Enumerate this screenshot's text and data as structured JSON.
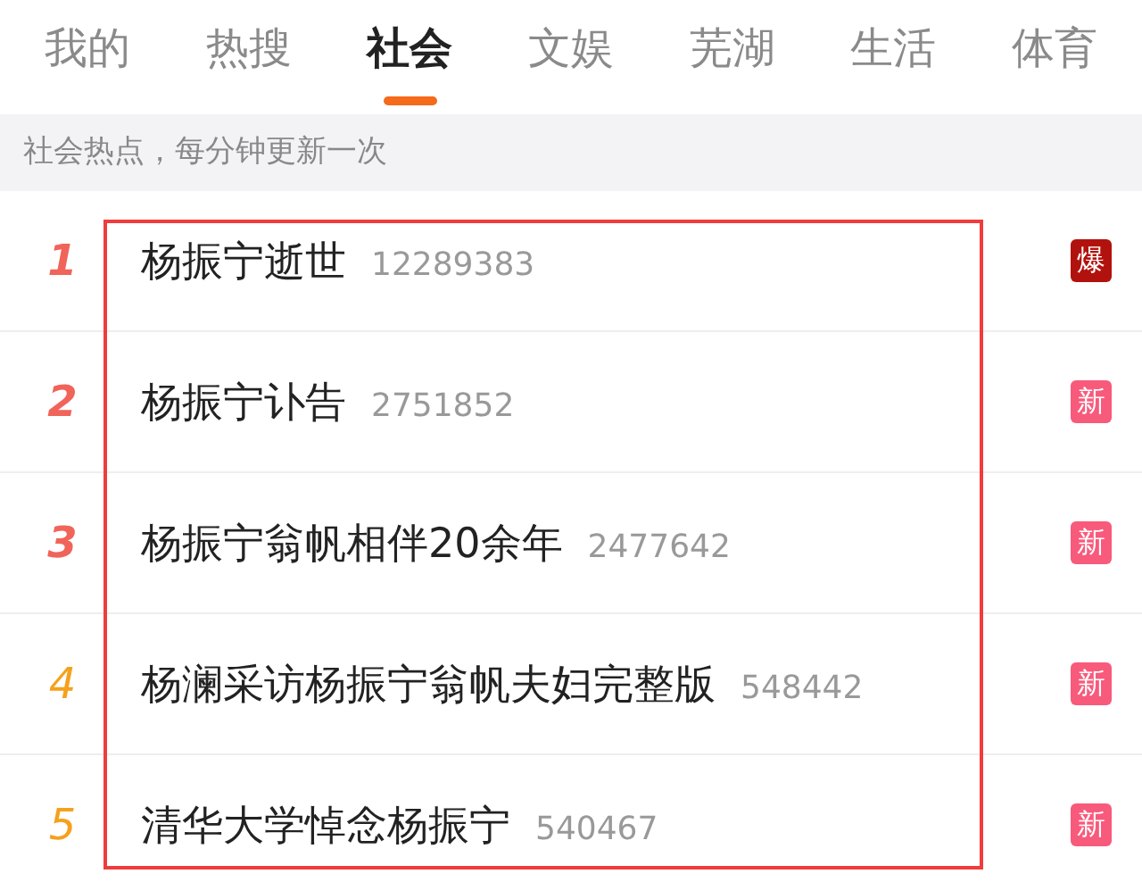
{
  "tabs": [
    {
      "label": "我的",
      "selected": false
    },
    {
      "label": "热搜",
      "selected": false
    },
    {
      "label": "社会",
      "selected": true
    },
    {
      "label": "文娱",
      "selected": false
    },
    {
      "label": "芜湖",
      "selected": false
    },
    {
      "label": "生活",
      "selected": false
    },
    {
      "label": "体育",
      "selected": false
    }
  ],
  "notice": "社会热点，每分钟更新一次",
  "items": [
    {
      "rank": "1",
      "kind": "top",
      "title": "杨振宁逝世",
      "count": "12289383",
      "badge": {
        "text": "爆",
        "kind": "hot"
      },
      "highlighted": true
    },
    {
      "rank": "2",
      "kind": "top",
      "title": "杨振宁讣告",
      "count": "2751852",
      "badge": {
        "text": "新",
        "kind": "new"
      },
      "highlighted": true
    },
    {
      "rank": "3",
      "kind": "top",
      "title": "杨振宁翁帆相伴20余年",
      "count": "2477642",
      "badge": {
        "text": "新",
        "kind": "new"
      },
      "highlighted": true
    },
    {
      "rank": "4",
      "kind": "normal",
      "title": "杨澜采访杨振宁翁帆夫妇完整版",
      "count": "548442",
      "badge": {
        "text": "新",
        "kind": "new"
      },
      "highlighted": true
    },
    {
      "rank": "5",
      "kind": "normal",
      "title": "清华大学悼念杨振宁",
      "count": "540467",
      "badge": {
        "text": "新",
        "kind": "new"
      },
      "highlighted": true
    }
  ]
}
